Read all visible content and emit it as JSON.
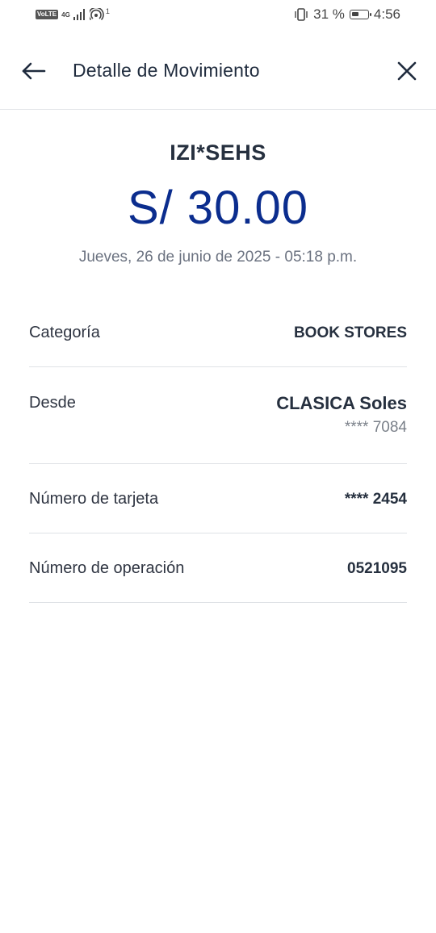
{
  "status_bar": {
    "network_badge": "VoLTE",
    "network_type": "4G",
    "hotspot_superscript": "1",
    "battery_percent": "31 %",
    "battery_level": 0.31,
    "time": "4:56"
  },
  "header": {
    "title": "Detalle de Movimiento",
    "back_icon": "arrow-left-icon",
    "close_icon": "close-icon"
  },
  "summary": {
    "merchant": "IZI*SEHS",
    "amount": "S/ 30.00",
    "datetime": "Jueves, 26 de junio de 2025 - 05:18 p.m."
  },
  "details": {
    "categoria_label": "Categoría",
    "categoria_value": "BOOK STORES",
    "desde_label": "Desde",
    "desde_value": "CLASICA Soles",
    "desde_sub": "**** 7084",
    "tarjeta_label": "Número de tarjeta",
    "tarjeta_value": "**** 2454",
    "operacion_label": "Número de operación",
    "operacion_value": "0521095"
  },
  "colors": {
    "amount": "#0b2d8e",
    "text_dark": "#26303f",
    "text_muted": "#6b7280",
    "divider": "#dfe2e6"
  }
}
